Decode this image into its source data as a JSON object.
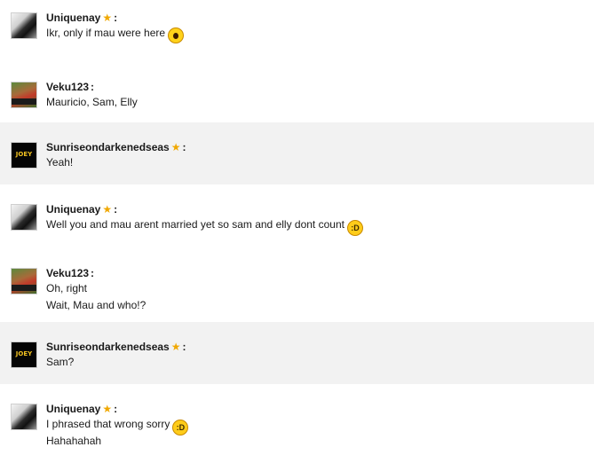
{
  "messages": [
    {
      "user": "Uniquenay",
      "star": "★",
      "colon": ":",
      "lines": [
        "Ikr, only if mau were here"
      ],
      "emoji": [
        "surprised-emoji"
      ]
    },
    {
      "user": "Veku123",
      "star": "",
      "colon": ":",
      "lines": [
        "Mauricio, Sam, Elly"
      ]
    },
    {
      "user": "Sunriseondarkenedseas",
      "star": "★",
      "colon": ":",
      "lines": [
        "Yeah!"
      ],
      "avatar_text": "JOEY"
    },
    {
      "user": "Uniquenay",
      "star": "★",
      "colon": ":",
      "lines": [
        "Well you and mau arent married yet so sam and elly dont count"
      ],
      "emoji": [
        "laughing-emoji"
      ],
      "emoji_glyph": ":D"
    },
    {
      "user": "Veku123",
      "star": "",
      "colon": ":",
      "lines": [
        "Oh, right",
        "Wait, Mau and who!?"
      ]
    },
    {
      "user": "Sunriseondarkenedseas",
      "star": "★",
      "colon": ":",
      "lines": [
        "Sam?"
      ],
      "avatar_text": "JOEY"
    },
    {
      "user": "Uniquenay",
      "star": "★",
      "colon": ":",
      "lines": [
        "I phrased that wrong sorry",
        "Hahahahah"
      ],
      "emoji": [
        "laughing-emoji"
      ],
      "emoji_glyph": ":D"
    }
  ],
  "colors": {
    "alt_row": "#f2f2f2",
    "star": "#f0a800",
    "emoji": "#ffcc1a"
  }
}
